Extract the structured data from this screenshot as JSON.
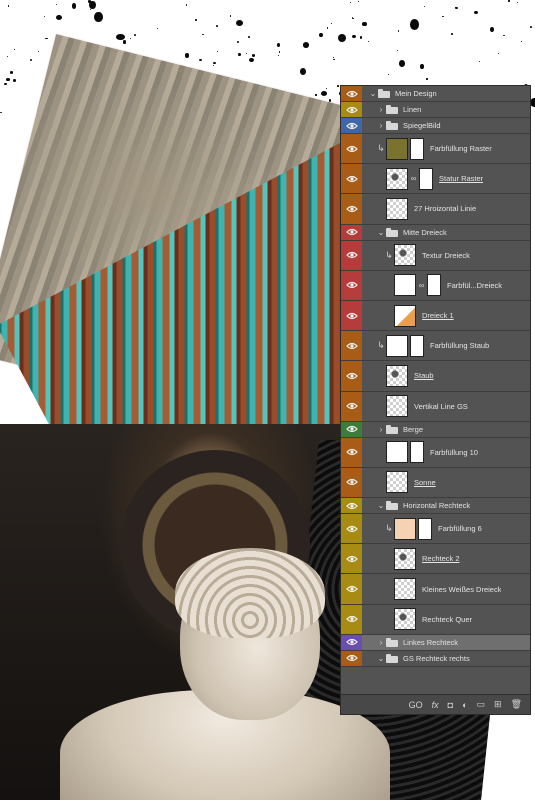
{
  "layers_panel": {
    "eye_colors": {
      "orange": "#a85c16",
      "yellow": "#a88b12",
      "blue": "#3f66a8",
      "red": "#b63b3b",
      "green": "#3d7d3a",
      "violet": "#6a4fb0",
      "none": "#535353"
    },
    "layers": [
      {
        "name": "Mein Design",
        "type": "group",
        "expanded": true,
        "depth": 0,
        "color": "orange"
      },
      {
        "name": "Linen",
        "type": "group",
        "expanded": false,
        "depth": 1,
        "color": "yellow"
      },
      {
        "name": "SpiegelBild",
        "type": "group",
        "expanded": false,
        "depth": 1,
        "color": "blue",
        "link": true,
        "mask": true
      },
      {
        "name": "Farbfüllung Raster",
        "type": "fill",
        "depth": 1,
        "color": "orange",
        "clip": true,
        "thumb": "olive",
        "mask": true
      },
      {
        "name": "Statur Raster",
        "type": "layer",
        "depth": 1,
        "color": "orange",
        "thumb": "photoish",
        "link": true,
        "mask": true,
        "underline": true
      },
      {
        "name": "27 Hroizontal Linie",
        "type": "layer",
        "depth": 1,
        "color": "orange",
        "thumb": "checker"
      },
      {
        "name": "Mitte Dreieck",
        "type": "group",
        "expanded": true,
        "depth": 1,
        "color": "red"
      },
      {
        "name": "Textur Dreieck",
        "type": "layer",
        "depth": 2,
        "color": "red",
        "clip": true,
        "thumb": "photoish"
      },
      {
        "name": "Farbfül...Dreieck",
        "type": "fill",
        "depth": 2,
        "color": "red",
        "thumb": "white",
        "link": true,
        "mask": true
      },
      {
        "name": "Dreieck 1",
        "type": "layer",
        "depth": 2,
        "color": "red",
        "thumb": "orange",
        "underline": true
      },
      {
        "name": "Farbfüllung Staub",
        "type": "fill",
        "depth": 1,
        "color": "orange",
        "clip": true,
        "thumb": "white",
        "mask": true
      },
      {
        "name": "Staub",
        "type": "layer",
        "depth": 1,
        "color": "orange",
        "thumb": "photoish",
        "underline": true
      },
      {
        "name": "Vertikal Line GS",
        "type": "layer",
        "depth": 1,
        "color": "orange",
        "thumb": "checker"
      },
      {
        "name": "Berge",
        "type": "group",
        "expanded": false,
        "depth": 1,
        "color": "green"
      },
      {
        "name": "Farbfüllung 10",
        "type": "fill",
        "depth": 1,
        "color": "orange",
        "thumb": "white",
        "mask": true
      },
      {
        "name": "Sonne",
        "type": "layer",
        "depth": 1,
        "color": "orange",
        "thumb": "checker",
        "underline": true
      },
      {
        "name": "Horizontal Rechteck",
        "type": "group",
        "expanded": true,
        "depth": 1,
        "color": "yellow"
      },
      {
        "name": "Farbfüllung 6",
        "type": "fill",
        "depth": 2,
        "color": "yellow",
        "clip": true,
        "thumb": "peach",
        "mask": true
      },
      {
        "name": "Rechteck 2",
        "type": "layer",
        "depth": 2,
        "color": "yellow",
        "thumb": "photoish",
        "underline": true
      },
      {
        "name": "Kleines Weißes Dreieck",
        "type": "layer",
        "depth": 2,
        "color": "yellow",
        "thumb": "checker"
      },
      {
        "name": "Rechteck Quer",
        "type": "layer",
        "depth": 2,
        "color": "yellow",
        "thumb": "photoish"
      },
      {
        "name": "Linkes Rechteck",
        "type": "group",
        "expanded": false,
        "depth": 1,
        "color": "violet",
        "selected": true
      },
      {
        "name": "GS Rechteck rechts",
        "type": "group",
        "expanded": true,
        "depth": 1,
        "color": "orange"
      }
    ],
    "bottom_icons": [
      "link-icon",
      "fx-icon",
      "add-mask-icon",
      "adjustment-icon",
      "new-group-icon",
      "new-layer-icon",
      "delete-icon"
    ],
    "bottom_labels": {
      "link": "GO",
      "fx": "fx",
      "mask": "◘",
      "adjust": "◐",
      "group": "▭",
      "new": "⊞",
      "delete": "🗑"
    }
  }
}
